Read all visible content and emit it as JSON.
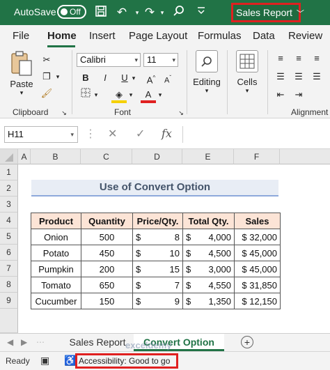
{
  "titlebar": {
    "autosave_label": "AutoSave",
    "toggle_state": "Off",
    "document_name": "Sales Report"
  },
  "ribbon_tabs": [
    "File",
    "Home",
    "Insert",
    "Page Layout",
    "Formulas",
    "Data",
    "Review"
  ],
  "active_tab": "Home",
  "ribbon": {
    "clipboard": {
      "paste_label": "Paste",
      "group_label": "Clipboard"
    },
    "font": {
      "font_name": "Calibri",
      "font_size": "11",
      "group_label": "Font",
      "bold": "B",
      "italic": "I",
      "underline": "U",
      "font_color": "A"
    },
    "editing_label": "Editing",
    "cells_label": "Cells",
    "alignment_label": "Alignment"
  },
  "formula_bar": {
    "name_box": "H11",
    "fx_label": "fx",
    "formula_value": ""
  },
  "grid": {
    "columns": [
      "A",
      "B",
      "C",
      "D",
      "E",
      "F"
    ],
    "rows": [
      "1",
      "2",
      "3",
      "4",
      "5",
      "6",
      "7",
      "8",
      "9"
    ]
  },
  "sheet": {
    "title": "Use of Convert Option",
    "headers": [
      "Product",
      "Quantity",
      "Price/Qty.",
      "Total Qty.",
      "Sales"
    ],
    "rows": [
      {
        "product": "Onion",
        "quantity": "500",
        "price_sym": "$",
        "price": "8",
        "total_sym": "$",
        "total": "4,000",
        "sales": "$ 32,000"
      },
      {
        "product": "Potato",
        "quantity": "450",
        "price_sym": "$",
        "price": "10",
        "total_sym": "$",
        "total": "4,500",
        "sales": "$ 45,000"
      },
      {
        "product": "Pumpkin",
        "quantity": "200",
        "price_sym": "$",
        "price": "15",
        "total_sym": "$",
        "total": "3,000",
        "sales": "$ 45,000"
      },
      {
        "product": "Tomato",
        "quantity": "650",
        "price_sym": "$",
        "price": "7",
        "total_sym": "$",
        "total": "4,550",
        "sales": "$ 31,850"
      },
      {
        "product": "Cucumber",
        "quantity": "150",
        "price_sym": "$",
        "price": "9",
        "total_sym": "$",
        "total": "1,350",
        "sales": "$ 12,150"
      }
    ]
  },
  "sheet_tabs": [
    "Sales Report",
    "Convert Option"
  ],
  "active_sheet": "Convert Option",
  "add_sheet_symbol": "+",
  "status": {
    "ready": "Ready",
    "accessibility": "Accessibility: Good to go"
  },
  "watermark": "exceldemy",
  "colors": {
    "excel_green": "#217346",
    "header_fill": "#fce4d6",
    "highlight_red": "#e02020"
  }
}
